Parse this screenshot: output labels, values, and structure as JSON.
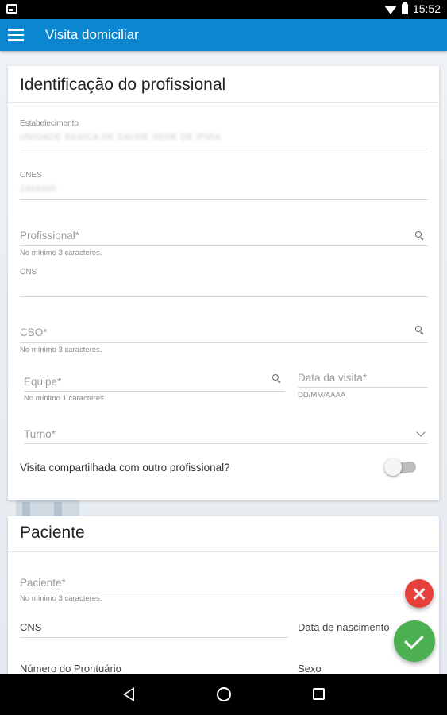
{
  "status_bar": {
    "time": "15:52"
  },
  "app_bar": {
    "title": "Visita domiciliar"
  },
  "professional_card": {
    "title": "Identificação do profissional",
    "estabelecimento": {
      "label": "Estabelecimento",
      "value": "UNIDADE BASICA DE SAUDE SEDE DE IPIRA"
    },
    "cnes": {
      "label": "CNES",
      "value": "2469405"
    },
    "profissional": {
      "label": "Profissional*",
      "helper": "No mínimo 3 caracteres."
    },
    "cns": {
      "label": "CNS"
    },
    "cbo": {
      "label": "CBO*",
      "helper": "No mínimo 3 caracteres."
    },
    "equipe": {
      "label": "Equipe*",
      "helper": "No mínimo 1 caracteres."
    },
    "data_visita": {
      "label": "Data da visita*",
      "helper": "DD/MM/AAAA"
    },
    "turno": {
      "label": "Turno*"
    },
    "compartilhada": {
      "label": "Visita compartilhada com outro profissional?",
      "checked": false
    }
  },
  "patient_card": {
    "title": "Paciente",
    "paciente": {
      "label": "Paciente*",
      "helper": "No mínimo 3 caracteres."
    },
    "cns": {
      "label": "CNS"
    },
    "data_nascimento": {
      "label": "Data de nascimento"
    },
    "prontuario": {
      "label": "Número do Prontuário"
    },
    "sexo": {
      "label": "Sexo"
    }
  },
  "icons": {
    "menu": "menu-icon",
    "search": "search-icon",
    "dropdown": "chevron-down-icon",
    "cancel": "close-icon",
    "save": "check-icon",
    "nav_back": "back-icon",
    "nav_home": "home-icon",
    "nav_recent": "recent-apps-icon"
  },
  "colors": {
    "app_bar": "#0b86d0",
    "cancel_fab": "#e5403a",
    "save_fab": "#4caf50"
  }
}
